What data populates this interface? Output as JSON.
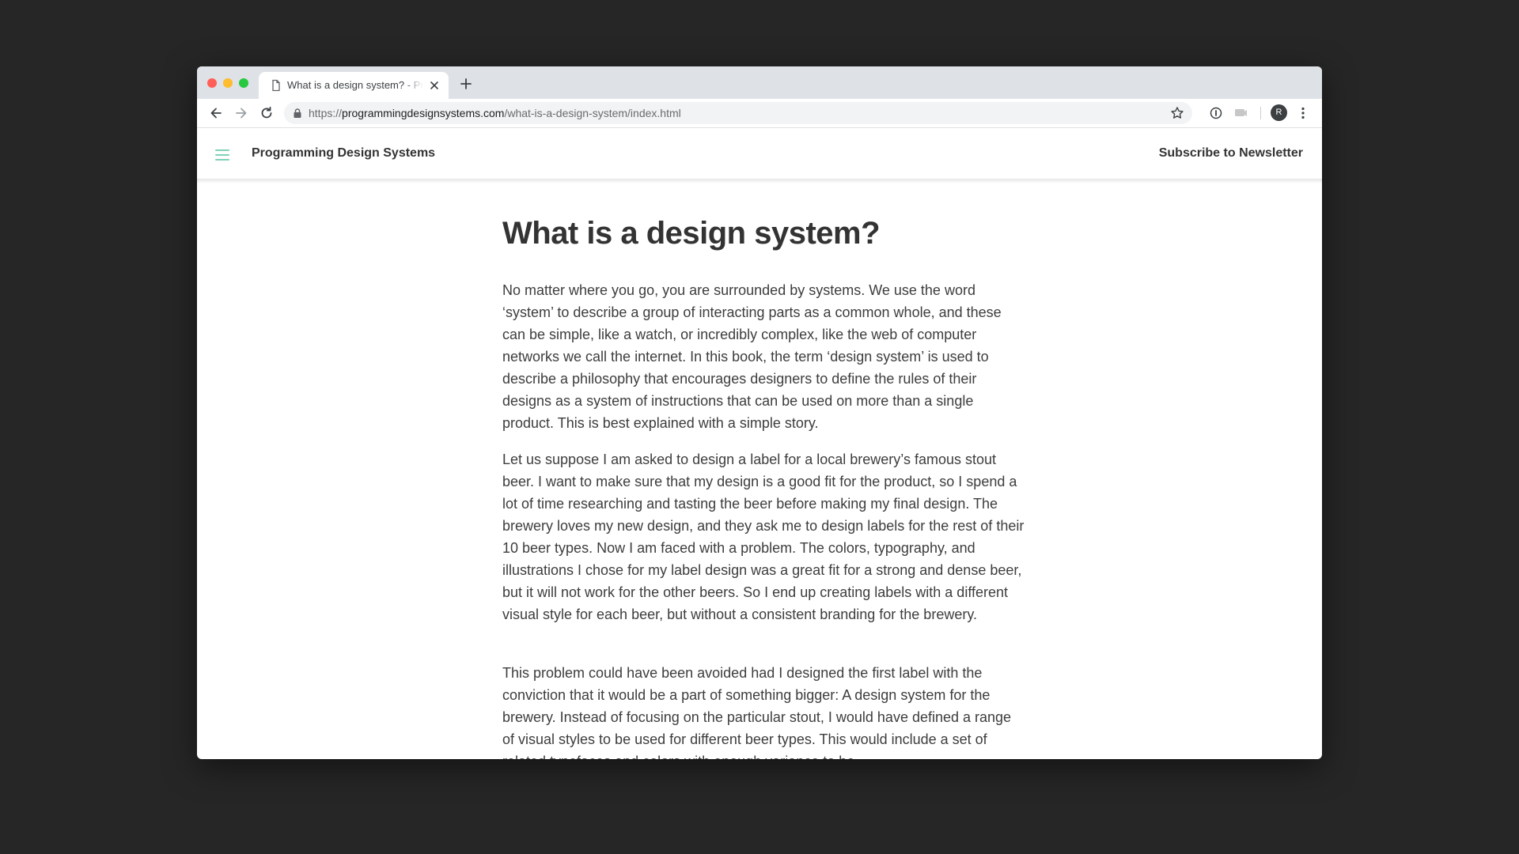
{
  "browser": {
    "tab_title": "What is a design system? - Programming Design Systems",
    "url_scheme": "https://",
    "url_host": "programmingdesignsystems.com",
    "url_path": "/what-is-a-design-system/index.html",
    "profile_initial": "R"
  },
  "site": {
    "title": "Programming Design Systems",
    "subscribe_label": "Subscribe to Newsletter",
    "accent_color": "#7fd1b9"
  },
  "article": {
    "heading": "What is a design system?",
    "paragraphs": [
      "No matter where you go, you are surrounded by systems. We use the word ‘system’ to describe a group of interacting parts as a common whole, and these can be simple, like a watch, or incredibly complex, like the web of computer networks we call the internet. In this book, the term ‘design system’ is used to describe a philosophy that encourages designers to define the rules of their designs as a system of instructions that can be used on more than a single product. This is best explained with a simple story.",
      "Let us suppose I am asked to design a label for a local brewery’s famous stout beer. I want to make sure that my design is a good fit for the product, so I spend a lot of time researching and tasting the beer before making my final design. The brewery loves my new design, and they ask me to design labels for the rest of their 10 beer types. Now I am faced with a problem. The colors, typography, and illustrations I chose for my label design was a great fit for a strong and dense beer, but it will not work for the other beers. So I end up creating labels with a different visual style for each beer, but without a consistent branding for the brewery.",
      "This problem could have been avoided had I designed the first label with the conviction that it would be a part of something bigger: A design system for the brewery. Instead of focusing on the particular stout, I would have defined a range of visual styles to be used for different beer types. This would include a set of related typefaces and colors with enough variance to be"
    ]
  }
}
